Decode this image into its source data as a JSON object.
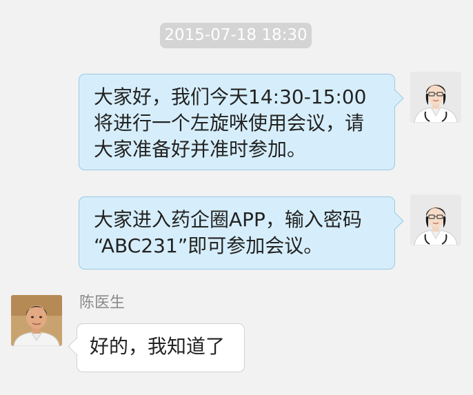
{
  "chat": {
    "timestamp": "2015-07-18 18:30",
    "messages": [
      {
        "direction": "outgoing",
        "avatar_icon": "female-doctor-avatar",
        "lines": [
          "大家好，我们今天14:30-15:00",
          "将进行一个左旋咪使用会议，请",
          "大家准备好并准时参加。"
        ]
      },
      {
        "direction": "outgoing",
        "avatar_icon": "female-doctor-avatar",
        "lines": [
          "大家进入药企圈APP，输入密码",
          "“ABC231”即可参加会议。"
        ]
      },
      {
        "direction": "incoming",
        "avatar_icon": "male-doctor-avatar",
        "sender": "陈医生",
        "lines": [
          "好的，我知道了"
        ]
      }
    ]
  },
  "colors": {
    "background": "#f2f2f2",
    "outgoing_bubble": "#d6eefb",
    "outgoing_border": "#9ac9e6",
    "incoming_bubble": "#ffffff",
    "timestamp_pill": "#d4d4d4"
  }
}
